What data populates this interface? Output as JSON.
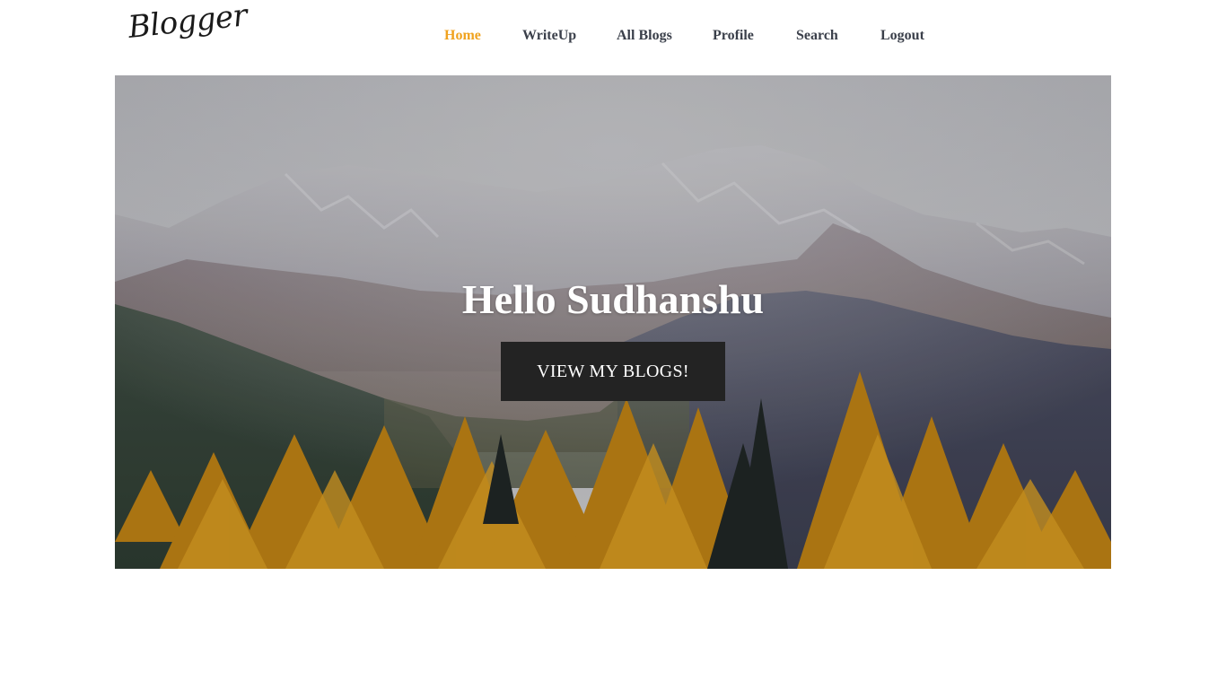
{
  "brand": {
    "logo_text": "Blogger"
  },
  "nav": {
    "items": [
      {
        "label": "Home",
        "active": true
      },
      {
        "label": "WriteUp",
        "active": false
      },
      {
        "label": "All Blogs",
        "active": false
      },
      {
        "label": "Profile",
        "active": false
      },
      {
        "label": "Search",
        "active": false
      },
      {
        "label": "Logout",
        "active": false
      }
    ]
  },
  "hero": {
    "title": "Hello Sudhanshu",
    "button_label": "VIEW MY BLOGS!",
    "background": "mountain-autumn-forest-photo"
  },
  "colors": {
    "accent": "#f0a21e",
    "nav_text": "#3a3f4a",
    "button_bg": "#232323"
  }
}
